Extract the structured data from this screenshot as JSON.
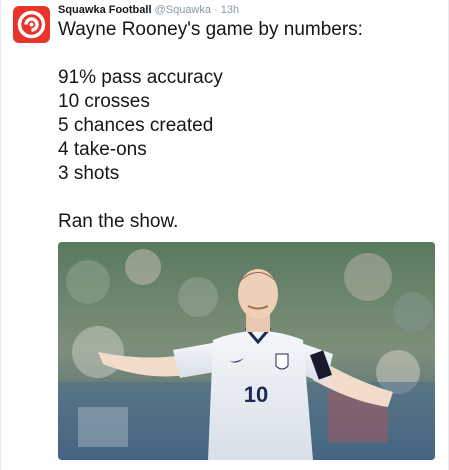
{
  "tweet": {
    "author_name": "Squawka Football",
    "author_handle": "@Squawka",
    "separator": "·",
    "timestamp": "13h",
    "text_lines": [
      "Wayne Rooney's game by numbers:",
      "",
      "91% pass accuracy",
      "10 crosses",
      "5 chances created",
      "4 take-ons",
      "3 shots",
      "",
      "Ran the show."
    ],
    "media": {
      "shirt_number": "10",
      "icon": "photo-player"
    }
  },
  "colors": {
    "brand_red": "#e8352b",
    "meta_gray": "#8899a6",
    "text": "#14171a"
  }
}
